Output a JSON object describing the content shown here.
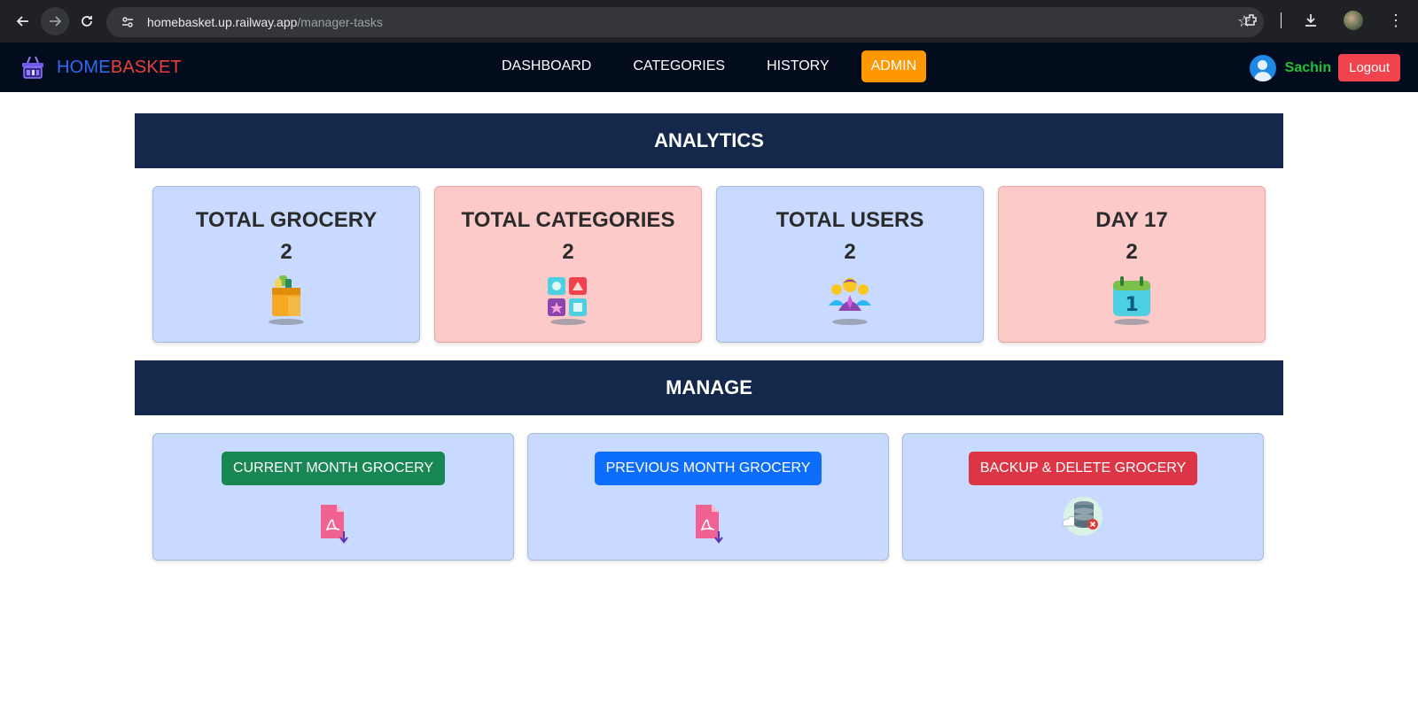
{
  "browser": {
    "url_host": "homebasket.up.railway.app",
    "url_path": "/manager-tasks"
  },
  "brand": {
    "home": "HOME",
    "basket": "BASKET"
  },
  "nav": {
    "links": [
      "DASHBOARD",
      "CATEGORIES",
      "HISTORY",
      "ADMIN"
    ],
    "active": "ADMIN"
  },
  "user": {
    "name": "Sachin",
    "logout_label": "Logout"
  },
  "analytics": {
    "title": "ANALYTICS",
    "cards": [
      {
        "title": "TOTAL GROCERY",
        "value": "2",
        "icon": "grocery-bag-icon",
        "color": "#c8daff"
      },
      {
        "title": "TOTAL CATEGORIES",
        "value": "2",
        "icon": "categories-icon",
        "color": "#fdcaca"
      },
      {
        "title": "TOTAL USERS",
        "value": "2",
        "icon": "users-icon",
        "color": "#c8daff"
      },
      {
        "title": "DAY 17",
        "value": "2",
        "icon": "calendar-icon",
        "color": "#fdcaca"
      }
    ]
  },
  "manage": {
    "title": "MANAGE",
    "actions": [
      {
        "label": "CURRENT MONTH GROCERY",
        "color": "#198754",
        "icon": "pdf-download-icon"
      },
      {
        "label": "PREVIOUS MONTH GROCERY",
        "color": "#0d6efd",
        "icon": "pdf-download-icon"
      },
      {
        "label": "BACKUP & DELETE GROCERY",
        "color": "#dc3545",
        "icon": "database-delete-icon"
      }
    ]
  },
  "colors": {
    "nav_bg": "#030c1d",
    "header_bg": "#14284b",
    "accent": "#ff9800",
    "brand_home": "#2f6bf0",
    "brand_basket": "#e8403b",
    "user_name": "#22c03a",
    "logout": "#f0434e"
  }
}
